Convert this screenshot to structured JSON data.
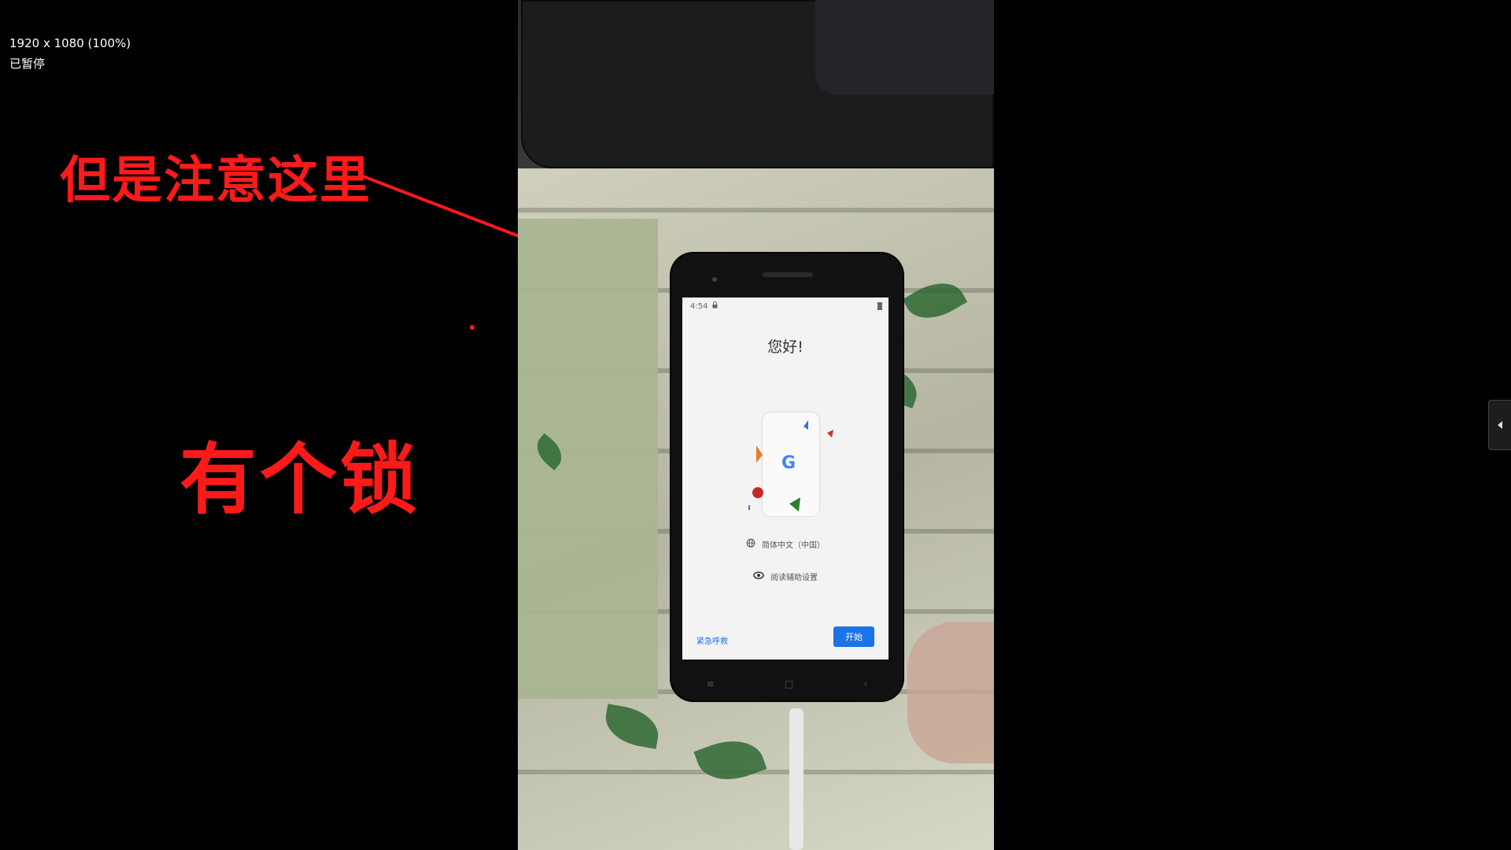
{
  "player": {
    "resolution_text": "1920 x 1080 (100%)",
    "status_text": "已暂停"
  },
  "annotations": {
    "pointer_text": "但是注意这里",
    "lock_text": "有个锁",
    "color": "#ff1a1a"
  },
  "phone_screen": {
    "status_time": "4:54",
    "greeting": "您好!",
    "g_logo": "G",
    "language_label": "简体中文（中国）",
    "accessibility_label": "阅读辅助设置",
    "emergency_label": "紧急呼救",
    "start_label": "开始",
    "accent_color": "#1a73e8"
  },
  "icons": {
    "lock": "lock-icon",
    "globe": "globe-icon",
    "eye": "eye-icon",
    "side_toggle": "chevron-left-icon"
  }
}
